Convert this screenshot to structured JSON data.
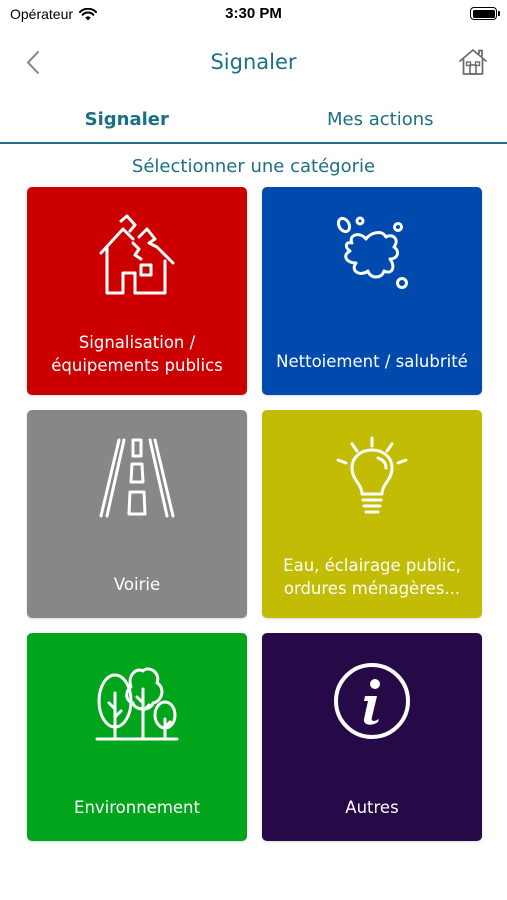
{
  "status_bar": {
    "carrier": "Opérateur",
    "time": "3:30 PM"
  },
  "nav": {
    "title": "Signaler",
    "back_icon": "chevron-left-icon",
    "home_icon": "home-icon"
  },
  "tabs": [
    {
      "label": "Signaler",
      "active": true
    },
    {
      "label": "Mes actions",
      "active": false
    }
  ],
  "section_title": "Sélectionner une catégorie",
  "categories": [
    {
      "label": "Signalisation / équipements publics",
      "color": "#cc0000",
      "icon": "damaged-house-icon"
    },
    {
      "label": "Nettoiement / salubrité",
      "color": "#004aad",
      "icon": "splash-stain-icon"
    },
    {
      "label": "Voirie",
      "color": "#878787",
      "icon": "road-icon"
    },
    {
      "label": "Eau, éclairage public, ordures ménagères...",
      "color": "#c2bc05",
      "icon": "light-bulb-icon"
    },
    {
      "label": "Environnement",
      "color": "#00a51c",
      "icon": "trees-icon"
    },
    {
      "label": "Autres",
      "color": "#260a47",
      "icon": "info-icon"
    }
  ],
  "colors": {
    "accent": "#1b6f86"
  }
}
